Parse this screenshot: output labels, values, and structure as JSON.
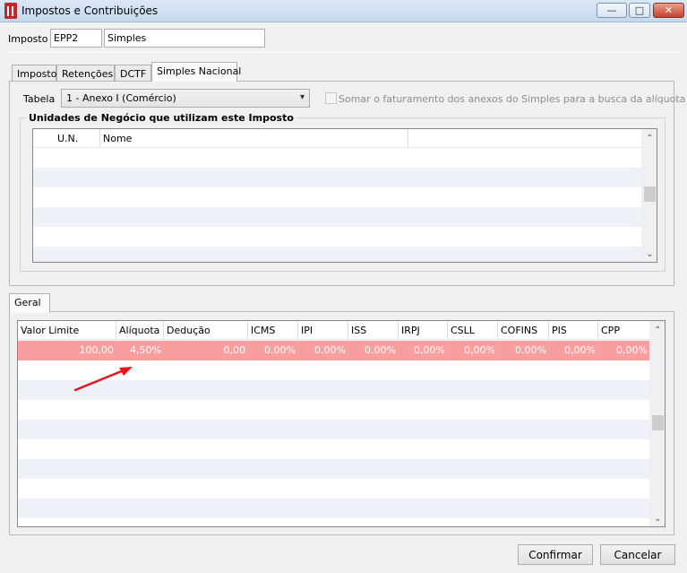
{
  "window": {
    "title": "Impostos e Contribuições",
    "minimize": "—",
    "maximize": "□",
    "close": "✕"
  },
  "imposto": {
    "label": "Imposto",
    "code": "EPP2",
    "name": "Simples"
  },
  "tabs": [
    "Imposto",
    "Retenções",
    "DCTF",
    "Simples Nacional"
  ],
  "active_tab": "Simples Nacional",
  "simples": {
    "tabela_label": "Tabela",
    "tabela_value": "1 - Anexo I (Comércio)",
    "somar_label": "Somar o faturamento dos anexos do Simples para a busca da alíquota",
    "somar_checked": false,
    "unidades_title": "Unidades de Negócio que utilizam este Imposto",
    "unidades_columns": [
      "U.N.",
      "Nome"
    ]
  },
  "geral": {
    "tab_label": "Geral",
    "columns": [
      "Valor Limite",
      "Alíquota",
      "Dedução",
      "ICMS",
      "IPI",
      "ISS",
      "IRPJ",
      "CSLL",
      "COFINS",
      "PIS",
      "CPP"
    ],
    "rows": [
      [
        "100,00",
        "4,50%",
        "0,00",
        "0,00%",
        "0,00%",
        "0,00%",
        "0,00%",
        "0,00%",
        "0,00%",
        "0,00%",
        "0,00%"
      ]
    ]
  },
  "buttons": {
    "confirmar": "Confirmar",
    "cancelar": "Cancelar"
  },
  "colors": {
    "selected_row": "#f89e9e",
    "annotation_arrow": "#e8141c"
  }
}
